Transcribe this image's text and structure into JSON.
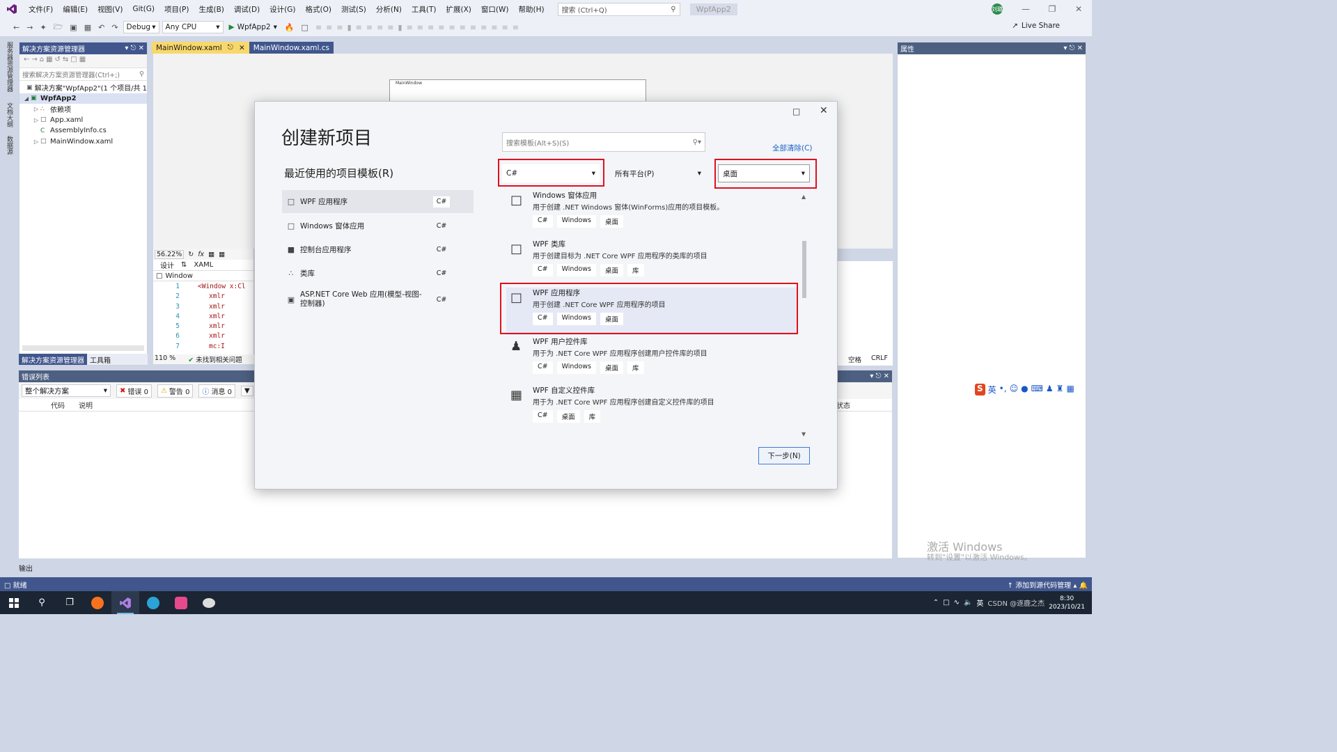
{
  "menubar": {
    "items": [
      "文件(F)",
      "编辑(E)",
      "视图(V)",
      "Git(G)",
      "项目(P)",
      "生成(B)",
      "调试(D)",
      "设计(G)",
      "格式(O)",
      "测试(S)",
      "分析(N)",
      "工具(T)",
      "扩展(X)",
      "窗口(W)",
      "帮助(H)"
    ],
    "search_placeholder": "搜索 (Ctrl+Q)",
    "project_name": "WpfApp2",
    "avatar": "刘璐"
  },
  "toolbar": {
    "config": "Debug",
    "platform": "Any CPU",
    "run_target": "WpfApp2",
    "live_share": "Live Share"
  },
  "left_strip": [
    "服务器资源管理器",
    "文档大纲",
    "数据源"
  ],
  "solution_explorer": {
    "title": "解决方案资源管理器",
    "search_placeholder": "搜索解决方案资源管理器(Ctrl+;)",
    "tree": [
      {
        "label": "解决方案\"WpfApp2\"(1 个项目/共 1"
      },
      {
        "label": "WpfApp2"
      },
      {
        "label": "依赖项"
      },
      {
        "label": "App.xaml"
      },
      {
        "label": "AssemblyInfo.cs"
      },
      {
        "label": "MainWindow.xaml"
      }
    ],
    "tabs": [
      "解决方案资源管理器",
      "工具箱"
    ]
  },
  "editor": {
    "tabs": [
      "MainWindow.xaml",
      "MainWindow.xaml.cs"
    ],
    "designer_window_title": "MainWindow",
    "zoom": "56.22%",
    "design_tab": "设计",
    "xaml_tab": "XAML",
    "element_scope": "Window",
    "code_lines": [
      {
        "n": "1",
        "t": "<Window x:Cl"
      },
      {
        "n": "2",
        "t": "xmlr"
      },
      {
        "n": "3",
        "t": "xmlr"
      },
      {
        "n": "4",
        "t": "xmlr"
      },
      {
        "n": "5",
        "t": "xmlr"
      },
      {
        "n": "6",
        "t": "xmlr"
      },
      {
        "n": "7",
        "t": "mc:I"
      }
    ],
    "code_zoom": "110 %",
    "issues": "未找到相关问题",
    "status_space": "空格",
    "status_eol": "CRLF"
  },
  "properties": {
    "title": "属性"
  },
  "error_list": {
    "title": "错误列表",
    "scope": "整个解决方案",
    "errors": "错误 0",
    "warnings": "警告 0",
    "messages": "消息 0",
    "columns": [
      "代码",
      "说明"
    ],
    "state_col": "状态"
  },
  "output_tab": "输出",
  "statusbar": {
    "left": "就绪",
    "right": "添加到源代码管理"
  },
  "watermark": {
    "line1": "激活 Windows",
    "line2": "转到\"设置\"以激活 Windows。"
  },
  "ime": {
    "lang": "英"
  },
  "taskbar": {
    "apps": [
      "start",
      "search",
      "task-view",
      "firefox",
      "visual-studio",
      "edge",
      "app-pink",
      "app-bird"
    ],
    "time": "8:30",
    "date": "2023/10/21",
    "ime_lang": "英",
    "csdn": "CSDN @逐鹿之杰"
  },
  "dialog": {
    "title": "创建新项目",
    "recent_heading": "最近使用的项目模板(R)",
    "recent": [
      {
        "name": "WPF 应用程序",
        "tag": "C#"
      },
      {
        "name": "Windows 窗体应用",
        "tag": "C#"
      },
      {
        "name": "控制台应用程序",
        "tag": "C#"
      },
      {
        "name": "类库",
        "tag": "C#"
      },
      {
        "name": "ASP.NET Core Web 应用(模型-视图-控制器)",
        "tag": "C#"
      }
    ],
    "search_placeholder": "搜索模板(Alt+S)(S)",
    "clear_all": "全部清除(C)",
    "filter_language": "C#",
    "filter_platform": "所有平台(P)",
    "filter_type": "桌面",
    "templates": [
      {
        "name": "Windows 窗体应用",
        "desc": "用于创建 .NET Windows 窗体(WinForms)应用的项目模板。",
        "tags": [
          "C#",
          "Windows",
          "桌面"
        ]
      },
      {
        "name": "WPF 类库",
        "desc": "用于创建目标为 .NET Core WPF 应用程序的类库的项目",
        "tags": [
          "C#",
          "Windows",
          "桌面",
          "库"
        ]
      },
      {
        "name": "WPF 应用程序",
        "desc": "用于创建 .NET Core WPF 应用程序的项目",
        "tags": [
          "C#",
          "Windows",
          "桌面"
        ]
      },
      {
        "name": "WPF 用户控件库",
        "desc": "用于为 .NET Core WPF 应用程序创建用户控件库的项目",
        "tags": [
          "C#",
          "Windows",
          "桌面",
          "库"
        ]
      },
      {
        "name": "WPF 自定义控件库",
        "desc": "用于为 .NET Core WPF 应用程序创建自定义控件库的项目",
        "tags": [
          "C#",
          "桌面",
          "库"
        ]
      }
    ],
    "next_button": "下一步(N)"
  }
}
